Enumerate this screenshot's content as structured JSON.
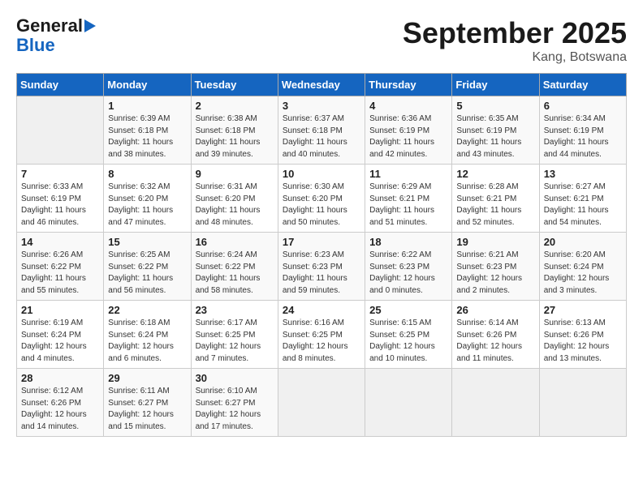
{
  "logo": {
    "general": "General",
    "blue": "Blue"
  },
  "header": {
    "month_title": "September 2025",
    "location": "Kang, Botswana"
  },
  "days_of_week": [
    "Sunday",
    "Monday",
    "Tuesday",
    "Wednesday",
    "Thursday",
    "Friday",
    "Saturday"
  ],
  "weeks": [
    [
      {
        "day": "",
        "info": ""
      },
      {
        "day": "1",
        "info": "Sunrise: 6:39 AM\nSunset: 6:18 PM\nDaylight: 11 hours\nand 38 minutes."
      },
      {
        "day": "2",
        "info": "Sunrise: 6:38 AM\nSunset: 6:18 PM\nDaylight: 11 hours\nand 39 minutes."
      },
      {
        "day": "3",
        "info": "Sunrise: 6:37 AM\nSunset: 6:18 PM\nDaylight: 11 hours\nand 40 minutes."
      },
      {
        "day": "4",
        "info": "Sunrise: 6:36 AM\nSunset: 6:19 PM\nDaylight: 11 hours\nand 42 minutes."
      },
      {
        "day": "5",
        "info": "Sunrise: 6:35 AM\nSunset: 6:19 PM\nDaylight: 11 hours\nand 43 minutes."
      },
      {
        "day": "6",
        "info": "Sunrise: 6:34 AM\nSunset: 6:19 PM\nDaylight: 11 hours\nand 44 minutes."
      }
    ],
    [
      {
        "day": "7",
        "info": "Sunrise: 6:33 AM\nSunset: 6:19 PM\nDaylight: 11 hours\nand 46 minutes."
      },
      {
        "day": "8",
        "info": "Sunrise: 6:32 AM\nSunset: 6:20 PM\nDaylight: 11 hours\nand 47 minutes."
      },
      {
        "day": "9",
        "info": "Sunrise: 6:31 AM\nSunset: 6:20 PM\nDaylight: 11 hours\nand 48 minutes."
      },
      {
        "day": "10",
        "info": "Sunrise: 6:30 AM\nSunset: 6:20 PM\nDaylight: 11 hours\nand 50 minutes."
      },
      {
        "day": "11",
        "info": "Sunrise: 6:29 AM\nSunset: 6:21 PM\nDaylight: 11 hours\nand 51 minutes."
      },
      {
        "day": "12",
        "info": "Sunrise: 6:28 AM\nSunset: 6:21 PM\nDaylight: 11 hours\nand 52 minutes."
      },
      {
        "day": "13",
        "info": "Sunrise: 6:27 AM\nSunset: 6:21 PM\nDaylight: 11 hours\nand 54 minutes."
      }
    ],
    [
      {
        "day": "14",
        "info": "Sunrise: 6:26 AM\nSunset: 6:22 PM\nDaylight: 11 hours\nand 55 minutes."
      },
      {
        "day": "15",
        "info": "Sunrise: 6:25 AM\nSunset: 6:22 PM\nDaylight: 11 hours\nand 56 minutes."
      },
      {
        "day": "16",
        "info": "Sunrise: 6:24 AM\nSunset: 6:22 PM\nDaylight: 11 hours\nand 58 minutes."
      },
      {
        "day": "17",
        "info": "Sunrise: 6:23 AM\nSunset: 6:23 PM\nDaylight: 11 hours\nand 59 minutes."
      },
      {
        "day": "18",
        "info": "Sunrise: 6:22 AM\nSunset: 6:23 PM\nDaylight: 12 hours\nand 0 minutes."
      },
      {
        "day": "19",
        "info": "Sunrise: 6:21 AM\nSunset: 6:23 PM\nDaylight: 12 hours\nand 2 minutes."
      },
      {
        "day": "20",
        "info": "Sunrise: 6:20 AM\nSunset: 6:24 PM\nDaylight: 12 hours\nand 3 minutes."
      }
    ],
    [
      {
        "day": "21",
        "info": "Sunrise: 6:19 AM\nSunset: 6:24 PM\nDaylight: 12 hours\nand 4 minutes."
      },
      {
        "day": "22",
        "info": "Sunrise: 6:18 AM\nSunset: 6:24 PM\nDaylight: 12 hours\nand 6 minutes."
      },
      {
        "day": "23",
        "info": "Sunrise: 6:17 AM\nSunset: 6:25 PM\nDaylight: 12 hours\nand 7 minutes."
      },
      {
        "day": "24",
        "info": "Sunrise: 6:16 AM\nSunset: 6:25 PM\nDaylight: 12 hours\nand 8 minutes."
      },
      {
        "day": "25",
        "info": "Sunrise: 6:15 AM\nSunset: 6:25 PM\nDaylight: 12 hours\nand 10 minutes."
      },
      {
        "day": "26",
        "info": "Sunrise: 6:14 AM\nSunset: 6:26 PM\nDaylight: 12 hours\nand 11 minutes."
      },
      {
        "day": "27",
        "info": "Sunrise: 6:13 AM\nSunset: 6:26 PM\nDaylight: 12 hours\nand 13 minutes."
      }
    ],
    [
      {
        "day": "28",
        "info": "Sunrise: 6:12 AM\nSunset: 6:26 PM\nDaylight: 12 hours\nand 14 minutes."
      },
      {
        "day": "29",
        "info": "Sunrise: 6:11 AM\nSunset: 6:27 PM\nDaylight: 12 hours\nand 15 minutes."
      },
      {
        "day": "30",
        "info": "Sunrise: 6:10 AM\nSunset: 6:27 PM\nDaylight: 12 hours\nand 17 minutes."
      },
      {
        "day": "",
        "info": ""
      },
      {
        "day": "",
        "info": ""
      },
      {
        "day": "",
        "info": ""
      },
      {
        "day": "",
        "info": ""
      }
    ]
  ]
}
